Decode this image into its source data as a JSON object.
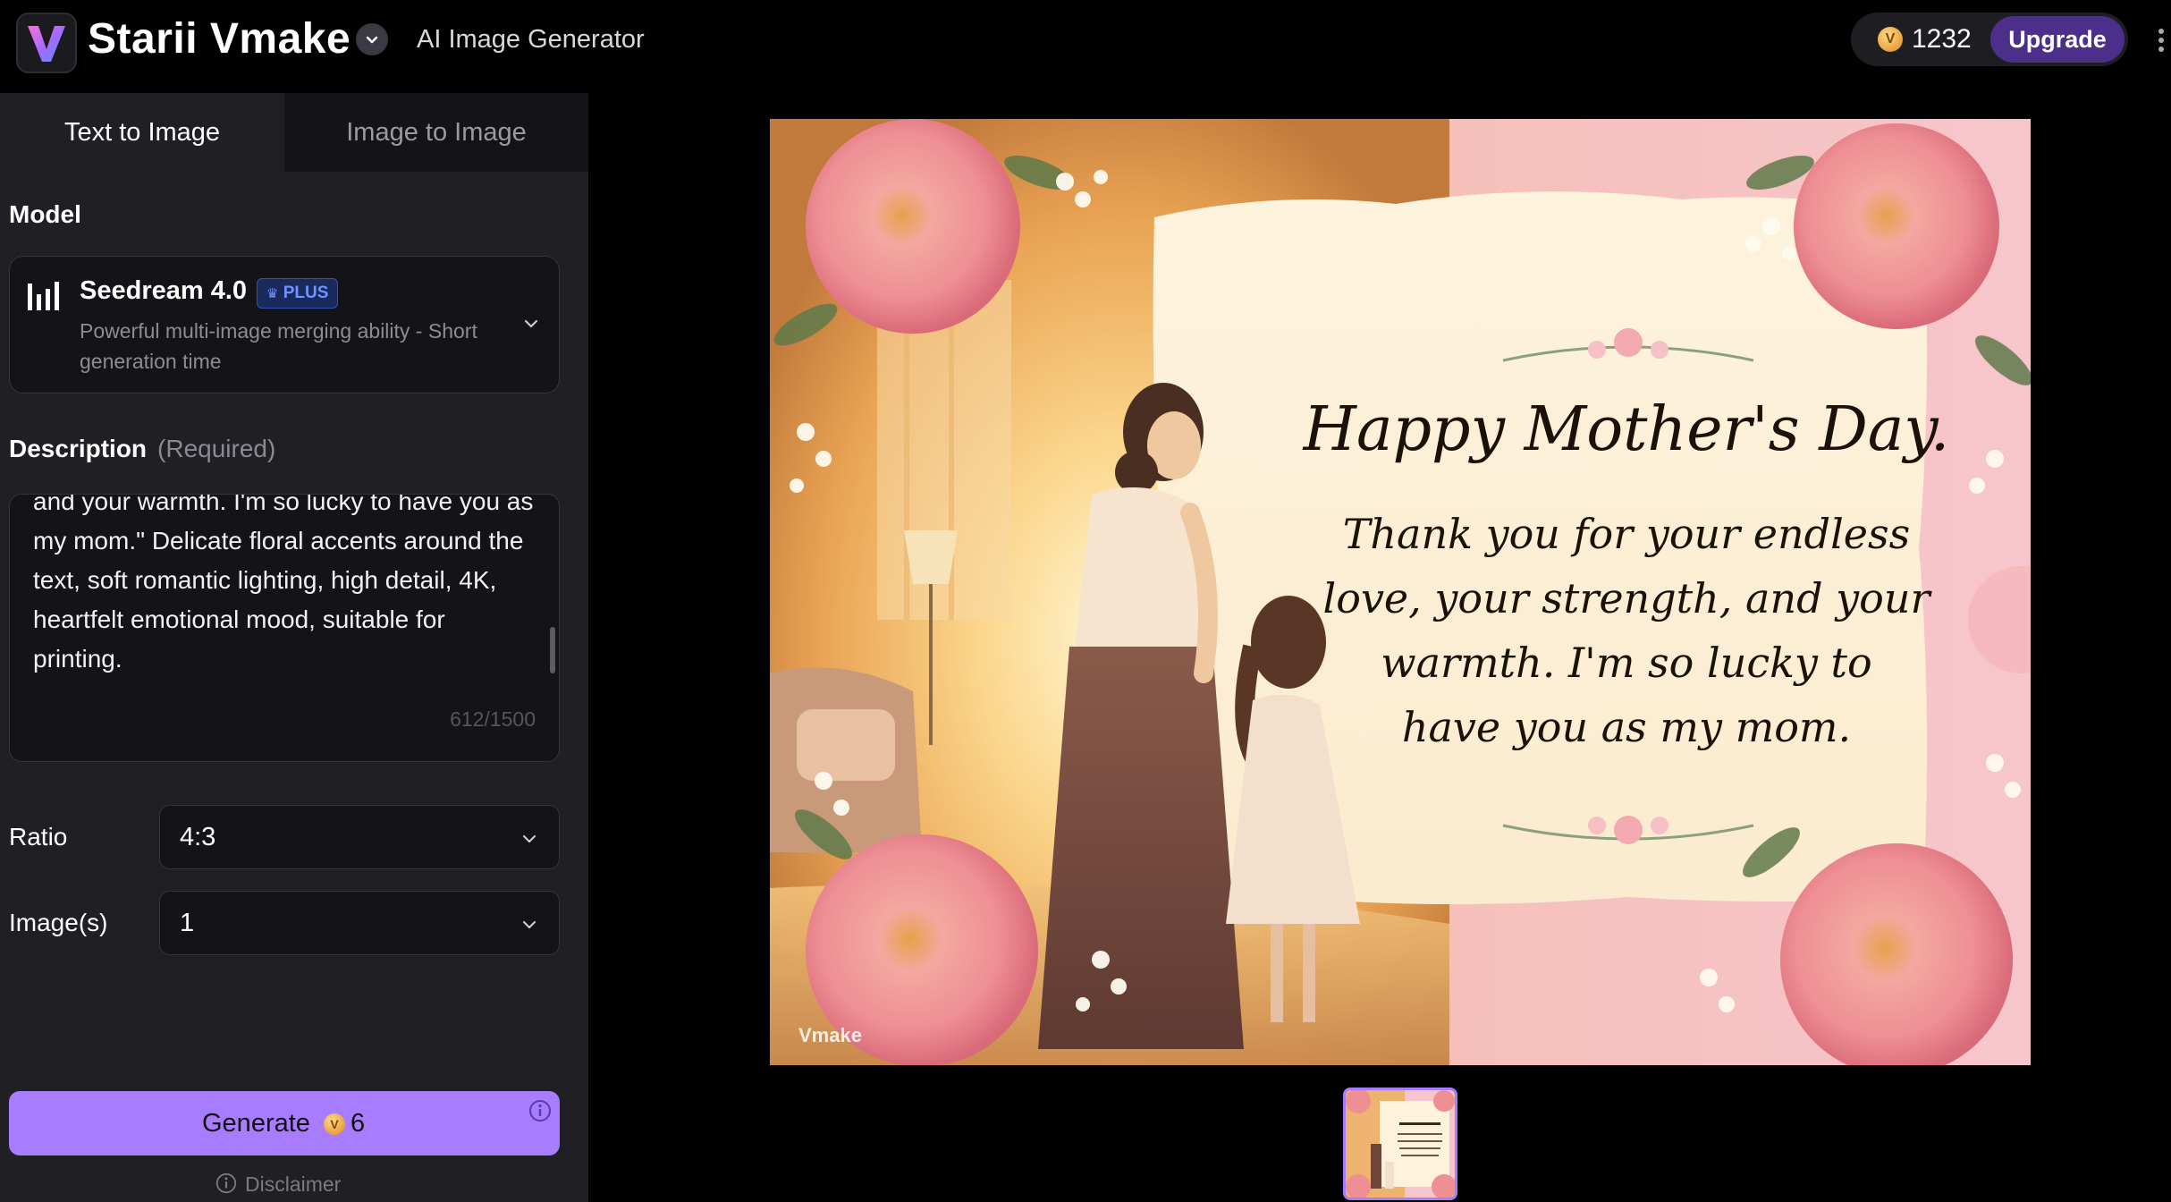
{
  "header": {
    "brand": "Starii Vmake",
    "subtitle": "AI Image Generator",
    "credits": "1232",
    "upgrade_label": "Upgrade"
  },
  "tabs": [
    {
      "label": "Text to Image",
      "active": true
    },
    {
      "label": "Image to Image",
      "active": false
    }
  ],
  "model": {
    "section_label": "Model",
    "name": "Seedream 4.0",
    "badge": "PLUS",
    "description": "Powerful multi-image merging ability - Short generation time"
  },
  "description": {
    "section_label": "Description",
    "required_label": "(Required)",
    "text": "and your warmth. I'm so lucky to have you as my mom.\" Delicate floral accents around the text, soft romantic lighting, high detail, 4K, heartfelt emotional mood, suitable for printing.",
    "char_count": "612/1500"
  },
  "ratio": {
    "label": "Ratio",
    "value": "4:3"
  },
  "images": {
    "label": "Image(s)",
    "value": "1"
  },
  "generate": {
    "label": "Generate",
    "cost": "6"
  },
  "disclaimer": "Disclaimer",
  "preview": {
    "card_title": "Happy Mother's Day.",
    "card_lines": [
      "Thank you for your endless",
      "love, your strength, and your",
      "warmth. I'm so lucky to",
      "have you as my mom."
    ],
    "watermark": "Vmake"
  },
  "icons": {
    "logo": "vmake-logo-icon",
    "chevron": "chevron-down-icon",
    "coin": "coin-icon",
    "info": "info-icon",
    "model": "equalizer-icon"
  },
  "colors": {
    "accent": "#a87cff",
    "upgrade": "#4b2f8a",
    "panel": "#1f1f24"
  }
}
